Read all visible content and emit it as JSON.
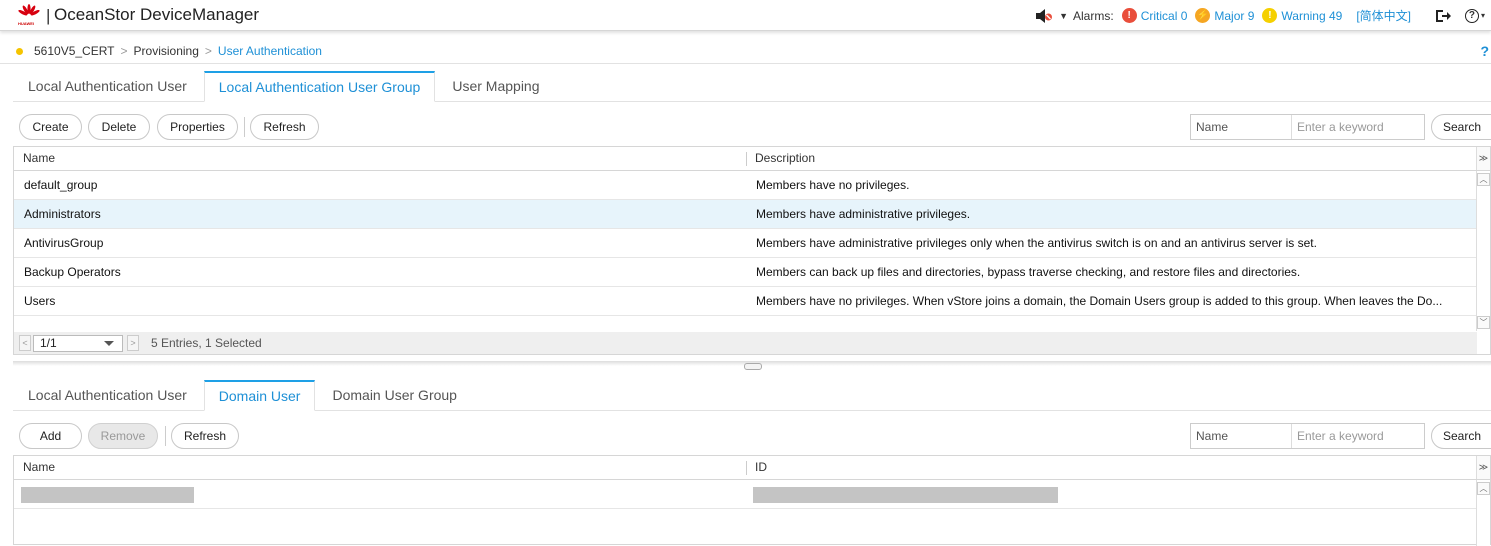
{
  "header": {
    "brand": "HUAWEI",
    "separator": "|",
    "app_title": "OceanStor DeviceManager",
    "alarms_label": "Alarms:",
    "critical": "Critical 0",
    "major": "Major 9",
    "warning": "Warning 49",
    "language": "[简体中文]"
  },
  "breadcrumb": {
    "device": "5610V5_CERT",
    "section": "Provisioning",
    "current": "User Authentication",
    "help": "?"
  },
  "top_panel": {
    "tabs": [
      "Local Authentication User",
      "Local Authentication User Group",
      "User Mapping"
    ],
    "active_tab": 1,
    "buttons": {
      "create": "Create",
      "delete": "Delete",
      "properties": "Properties",
      "refresh": "Refresh"
    },
    "search": {
      "field": "Name",
      "placeholder": "Enter a keyword",
      "button": "Search"
    },
    "columns": [
      "Name",
      "Description"
    ],
    "rows": [
      {
        "name": "default_group",
        "description": "Members have no privileges."
      },
      {
        "name": "Administrators",
        "description": "Members have administrative privileges."
      },
      {
        "name": "AntivirusGroup",
        "description": "Members have administrative privileges only when the antivirus switch is on and an antivirus server is set."
      },
      {
        "name": "Backup Operators",
        "description": "Members can back up files and directories, bypass traverse checking, and restore files and directories."
      },
      {
        "name": "Users",
        "description": "Members have no privileges. When vStore joins a domain, the Domain Users group is added to this group. When leaves the Do..."
      }
    ],
    "selected_row": 1,
    "pager": {
      "page": "1/1",
      "summary": "5 Entries, 1 Selected"
    }
  },
  "bottom_panel": {
    "tabs": [
      "Local Authentication User",
      "Domain User",
      "Domain User Group"
    ],
    "active_tab": 1,
    "buttons": {
      "add": "Add",
      "remove": "Remove",
      "refresh": "Refresh"
    },
    "search": {
      "field": "Name",
      "placeholder": "Enter a keyword",
      "button": "Search"
    },
    "columns": [
      "Name",
      "ID"
    ]
  },
  "colors": {
    "accent": "#1e90d6",
    "critical": "#e94e3b",
    "major": "#f5a623",
    "warning": "#f5d000",
    "selected_row": "#e7f4fb"
  }
}
